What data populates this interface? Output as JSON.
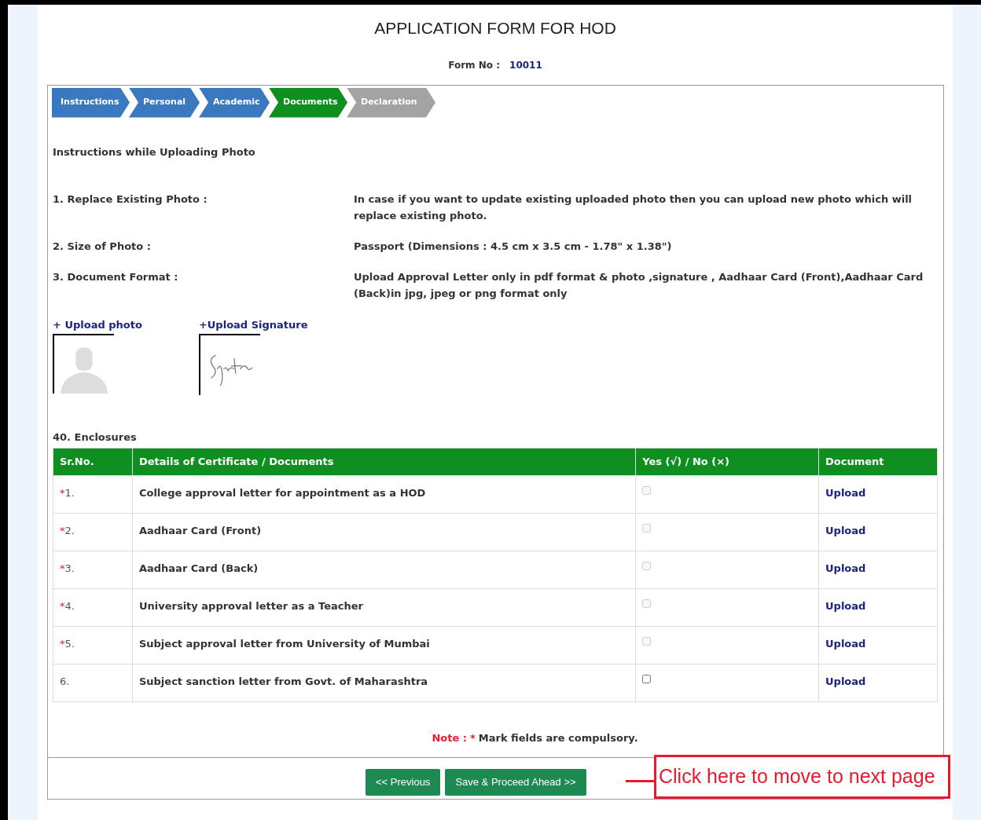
{
  "title": "APPLICATION FORM FOR HOD",
  "form_no": {
    "label": "Form No :",
    "value": "10011"
  },
  "steps": [
    {
      "label": "Instructions",
      "completed": true,
      "selected": false
    },
    {
      "label": "Personal",
      "completed": true,
      "selected": false
    },
    {
      "label": "Academic",
      "completed": true,
      "selected": false
    },
    {
      "label": "Documents",
      "completed": false,
      "selected": true
    },
    {
      "label": "Declaration",
      "completed": false,
      "selected": false
    }
  ],
  "instructions_heading": "Instructions while Uploading Photo",
  "instructions": [
    {
      "label": "1. Replace Existing Photo :",
      "text": "In case if you want to update existing uploaded photo then you can upload new photo which will replace existing photo."
    },
    {
      "label": "2. Size of Photo :",
      "text": "Passport (Dimensions : 4.5 cm x 3.5 cm - 1.78\" x 1.38\")"
    },
    {
      "label": "3. Document Format :",
      "text": "Upload Approval Letter only in pdf format & photo ,signature , Aadhaar Card (Front),Aadhaar Card (Back)in jpg, jpeg or png format only"
    }
  ],
  "uploads": [
    {
      "label": "+ Upload photo",
      "kind": "photo"
    },
    {
      "label": "+Upload Signature",
      "kind": "signature"
    }
  ],
  "enclosures_heading": "40. Enclosures",
  "table": {
    "columns": [
      "Sr.No.",
      "Details of Certificate / Documents",
      "Yes (√) / No (×)",
      "Document"
    ],
    "rows": [
      {
        "required": true,
        "sr": "1.",
        "details": "College approval letter for appointment as a HOD",
        "disabled": true,
        "checked": false,
        "link": "Upload"
      },
      {
        "required": true,
        "sr": "2.",
        "details": "Aadhaar Card (Front)",
        "disabled": true,
        "checked": false,
        "link": "Upload"
      },
      {
        "required": true,
        "sr": "3.",
        "details": "Aadhaar Card (Back)",
        "disabled": true,
        "checked": false,
        "link": "Upload"
      },
      {
        "required": true,
        "sr": "4.",
        "details": "University approval letter as a Teacher",
        "disabled": true,
        "checked": false,
        "link": "Upload"
      },
      {
        "required": true,
        "sr": "5.",
        "details": "Subject approval letter from University of Mumbai",
        "disabled": true,
        "checked": false,
        "link": "Upload"
      },
      {
        "required": false,
        "sr": "6.",
        "details": "Subject sanction letter from Govt. of Maharashtra",
        "disabled": false,
        "checked": false,
        "link": "Upload"
      }
    ]
  },
  "note": {
    "label": "Note :",
    "star": "*",
    "text": "Mark fields are compulsory."
  },
  "buttons": [
    "<< Previous",
    "Save & Proceed Ahead >>"
  ],
  "callout": "Click here to move to next page"
}
